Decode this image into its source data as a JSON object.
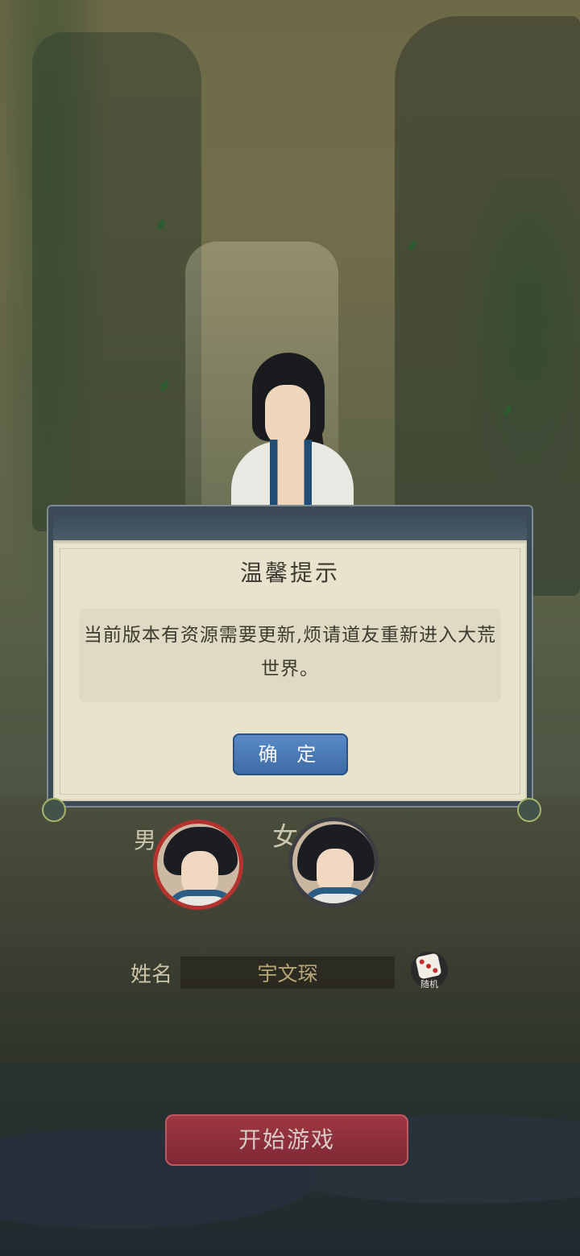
{
  "dialog": {
    "title": "温馨提示",
    "message": "当前版本有资源需要更新,烦请道友重新进入大荒世界。",
    "confirm_label": "确 定"
  },
  "character_select": {
    "male_label": "男",
    "female_label": "女",
    "selected_gender": "男",
    "name_label": "姓名",
    "name_value": "宇文琛",
    "random_label": "随机"
  },
  "actions": {
    "start_label": "开始游戏"
  },
  "colors": {
    "confirm_button": "#4a7ab6",
    "start_button": "#a5303d",
    "selected_ring": "#b5332f",
    "dialog_paper": "#e7e3cd"
  },
  "icons": {
    "random_dice": "dice-icon"
  }
}
